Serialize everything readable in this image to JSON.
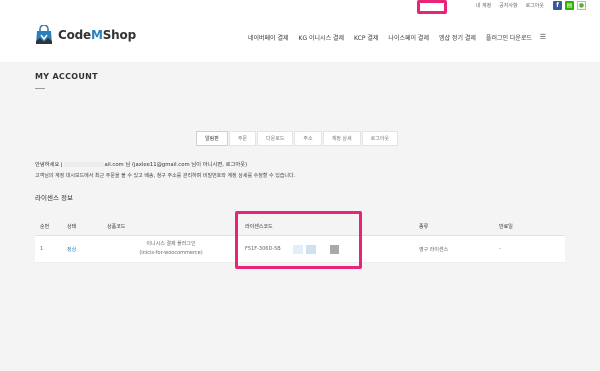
{
  "topbar": {
    "my_account": "내 계정",
    "notice": "공지사항",
    "logout": "로그아웃"
  },
  "brand": {
    "name_prefix": "Code",
    "name_m": "M",
    "name_suffix": "Shop",
    "accent": "#2a7fba"
  },
  "nav": {
    "items": [
      "네이버페이 결제",
      "KG 이니시스 결제",
      "KCP 결제",
      "나이스페이 결제",
      "엠샵 정기 결제",
      "플러그인 다운로드"
    ]
  },
  "page": {
    "title": "MY ACCOUNT"
  },
  "tabs": [
    "알림판",
    "주문",
    "다운로드",
    "주소",
    "계정 상세",
    "로그아웃"
  ],
  "greeting": {
    "prefix": "안녕하세요 j",
    "suffix": "ail.com 님 (jaxlee11@gmail.com 님이 아니시면, 로그아웃)"
  },
  "description": "고객님의 계정 대시보드에서 최근 주문을 볼 수 있고 배송, 청구 주소를 관리하며 비밀번호와 계정 상세를 수정할 수 있습니다.",
  "license_section": {
    "title": "라이센스 정보",
    "headers": [
      "순번",
      "상태",
      "상품코드",
      "라이센스코드",
      "종류",
      "만료일"
    ],
    "rows": [
      {
        "no": "1",
        "status": "정상",
        "product_line1": "이니시스 결제 플러그인",
        "product_line2": "(inicis-for-woocommerce)",
        "license": "F51F-306D-5B",
        "type": "영구 라이센스",
        "expiry": "-"
      }
    ]
  },
  "highlight_color": "#e8247a"
}
